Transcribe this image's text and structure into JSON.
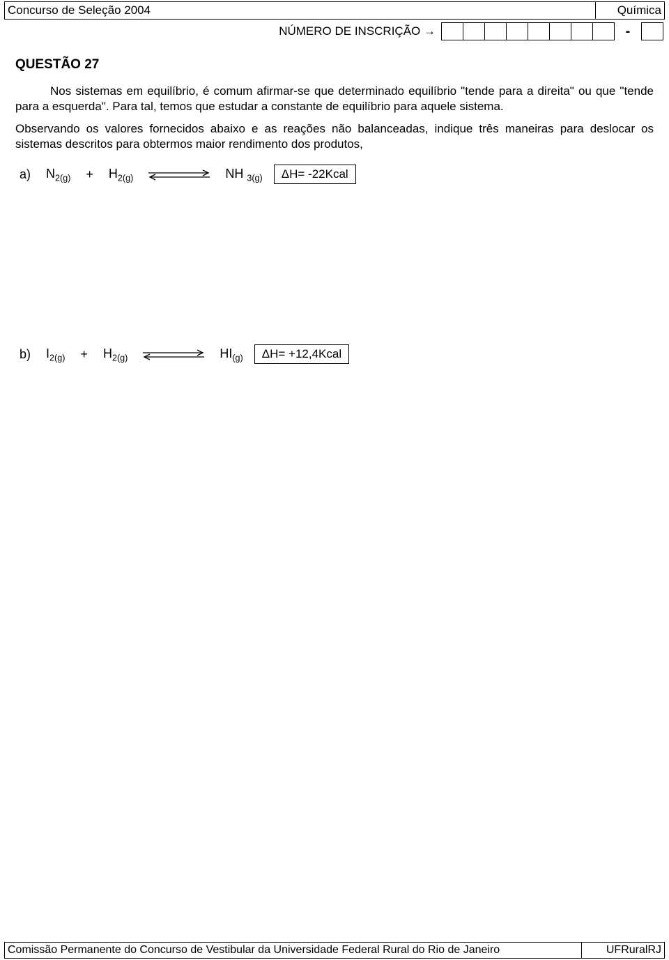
{
  "header": {
    "left": "Concurso de Seleção 2004",
    "right": "Química",
    "inscricao_label": "NÚMERO DE INSCRIÇÃO →",
    "box_count_left": 8,
    "box_sep": "-",
    "box_count_right": 1
  },
  "question": {
    "title": "QUESTÃO 27",
    "para1": "Nos sistemas em equilíbrio, é comum afirmar-se que determinado equilíbrio \"tende para a direita\" ou que  \"tende para a esquerda\". Para tal, temos que estudar a constante de equilíbrio para aquele sistema.",
    "para2": "Observando os valores fornecidos abaixo e as reações não balanceadas, indique três maneiras para deslocar os sistemas descritos para obtermos maior rendimento dos produtos,"
  },
  "reactions": {
    "a": {
      "label": "a)",
      "lhs1": "N",
      "lhs1_sub": "2(g)",
      "lhs2": "H",
      "lhs2_sub": "2(g)",
      "rhs": "NH",
      "rhs_sub": "3(g)",
      "dh": "ΔH= -22Kcal"
    },
    "b": {
      "label": "b)",
      "lhs1": "I",
      "lhs1_sub": "2(g)",
      "lhs2": "H",
      "lhs2_sub": "2(g)",
      "rhs": "HI",
      "rhs_sub": "(g)",
      "dh": "ΔH= +12,4Kcal"
    }
  },
  "footer": {
    "left": "Comissão Permanente do Concurso de Vestibular da Universidade Federal Rural do Rio de Janeiro",
    "right": "UFRuralRJ"
  }
}
